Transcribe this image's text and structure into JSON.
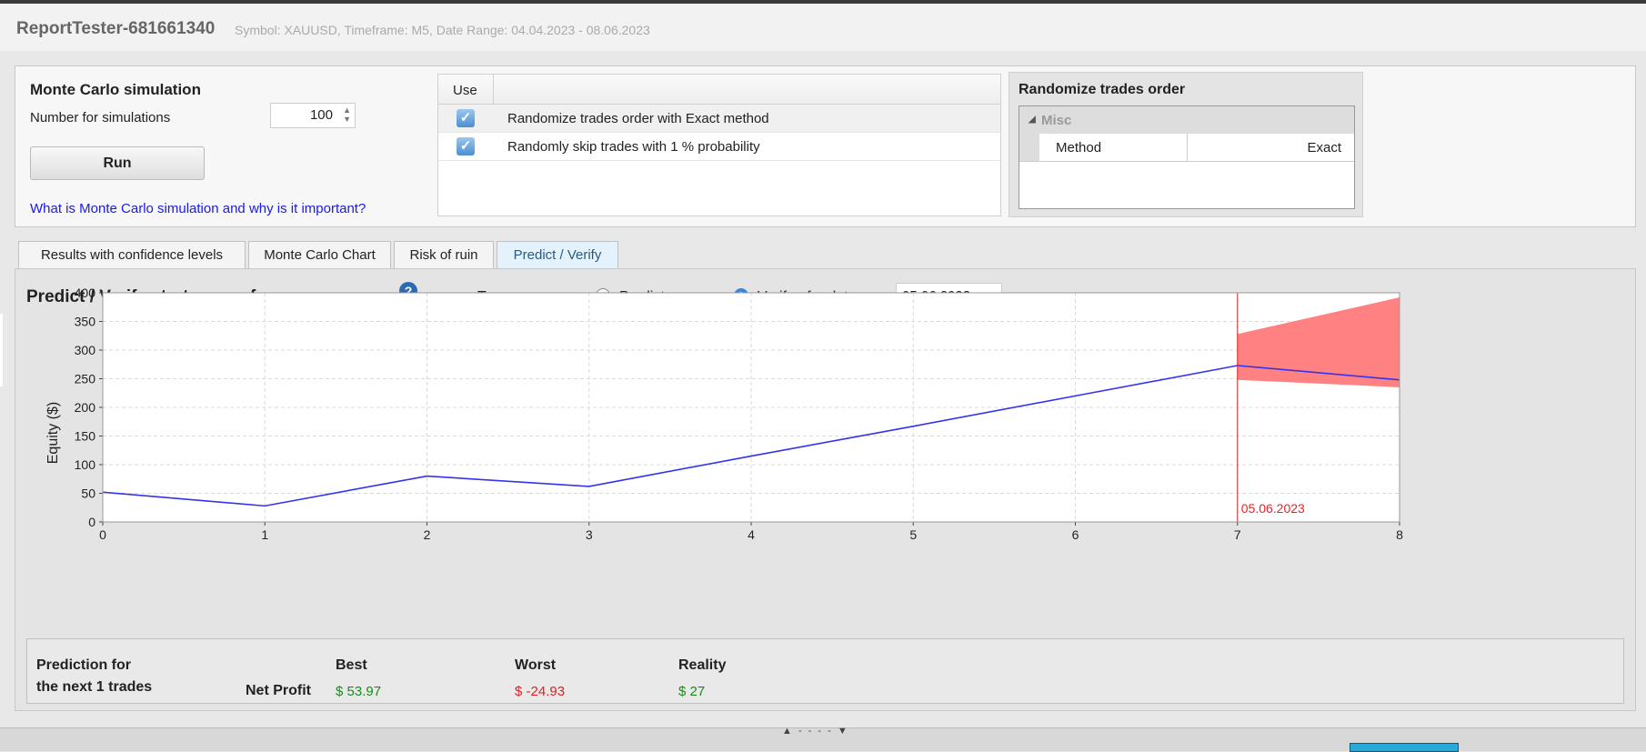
{
  "header": {
    "title": "ReportTester-681661340",
    "subtitle": "Symbol: XAUUSD, Timeframe: M5, Date Range: 04.04.2023 - 08.06.2023"
  },
  "monte_carlo": {
    "title": "Monte Carlo simulation",
    "num_label": "Number for simulations",
    "num_value": "100",
    "run_label": "Run",
    "help_link": "What is Monte Carlo simulation and why is it important?"
  },
  "use_table": {
    "header": "Use",
    "rows": [
      {
        "checked": true,
        "label": "Randomize trades order with Exact method"
      },
      {
        "checked": true,
        "label": "Randomly skip trades with 1 % probability"
      }
    ]
  },
  "randomize": {
    "title": "Randomize trades order",
    "group": "Misc",
    "key": "Method",
    "value": "Exact"
  },
  "tabs": [
    {
      "label": "Results with confidence levels",
      "active": false
    },
    {
      "label": "Monte Carlo Chart",
      "active": false
    },
    {
      "label": "Risk of ruin",
      "active": false
    },
    {
      "label": "Predict / Verify",
      "active": true
    }
  ],
  "predict": {
    "title": "Predict / Verify strategy performance",
    "type_label": "Type:",
    "option_predict": "Predict",
    "option_verify": "Verify - for date",
    "selected": "verify",
    "date": "05.06.2023"
  },
  "chart_data": {
    "type": "line",
    "ylabel": "Equity ($)",
    "xlim": [
      0,
      8
    ],
    "ylim": [
      0,
      400
    ],
    "x_ticks": [
      "0",
      "1",
      "2",
      "3",
      "4",
      "5",
      "6",
      "7",
      "8"
    ],
    "y_ticks": [
      "0",
      "50",
      "100",
      "150",
      "200",
      "250",
      "300",
      "350",
      "400"
    ],
    "grid": true,
    "series": [
      {
        "x": [
          0,
          1,
          2,
          3,
          4,
          5,
          6,
          7,
          8
        ],
        "y": [
          52,
          28,
          80,
          62,
          115,
          167,
          220,
          273,
          248
        ],
        "color": "#3333ee"
      }
    ],
    "band": {
      "x": [
        7,
        8
      ],
      "upper": [
        328,
        392
      ],
      "lower": [
        248,
        235
      ],
      "color": "#ff7a7a"
    },
    "vline": {
      "x": 7,
      "label": "05.06.2023",
      "color": "#ee2222"
    }
  },
  "prediction": {
    "label_line1": "Prediction for",
    "label_line2": "the next 1 trades",
    "row_label": "Net Profit",
    "best_header": "Best",
    "worst_header": "Worst",
    "reality_header": "Reality",
    "best": "$ 53.97",
    "worst": "$ -24.93",
    "reality": "$ 27",
    "colors": {
      "positive": "#1a8a1a",
      "negative": "#dd2222"
    }
  }
}
